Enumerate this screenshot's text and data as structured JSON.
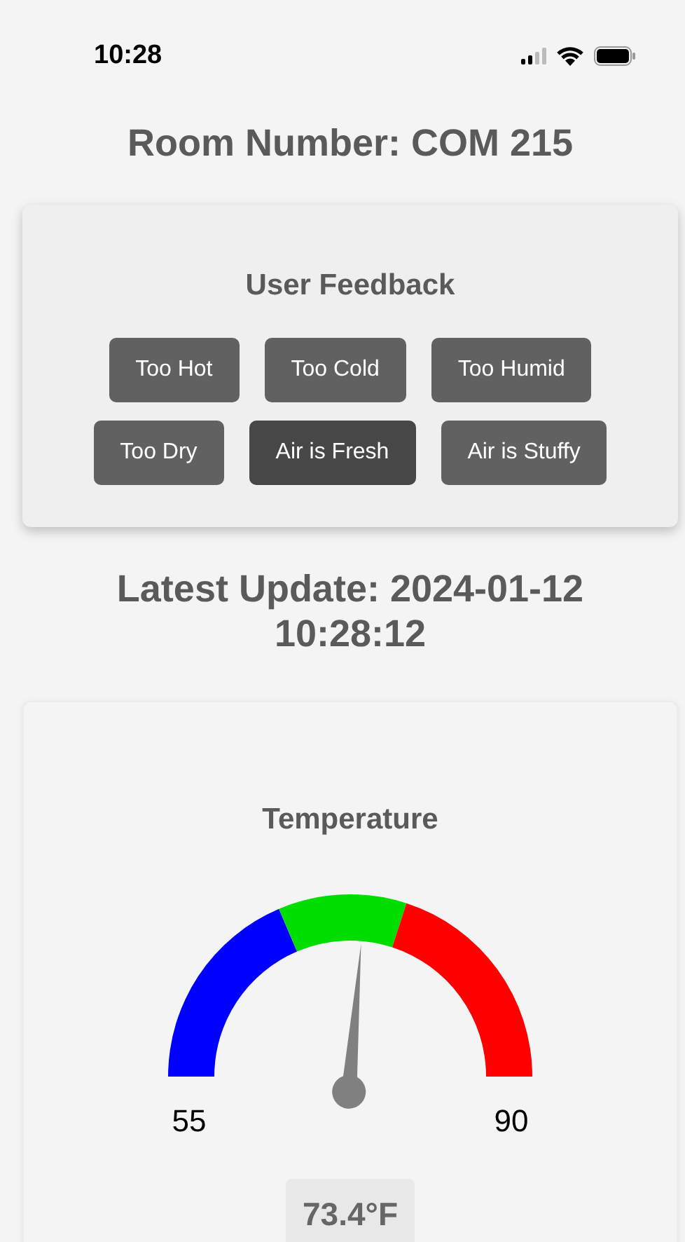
{
  "status_bar": {
    "time": "10:28"
  },
  "room_title": "Room Number: COM 215",
  "feedback": {
    "title": "User Feedback",
    "buttons": [
      {
        "label": "Too Hot",
        "selected": false
      },
      {
        "label": "Too Cold",
        "selected": false
      },
      {
        "label": "Too Humid",
        "selected": false
      },
      {
        "label": "Too Dry",
        "selected": false
      },
      {
        "label": "Air is Fresh",
        "selected": true
      },
      {
        "label": "Air is Stuffy",
        "selected": false
      }
    ]
  },
  "latest_update": "Latest Update: 2024-01-12 10:28:12",
  "temperature": {
    "title": "Temperature",
    "min_label": "55",
    "max_label": "90",
    "zones": [
      {
        "color": "#0000ff"
      },
      {
        "color": "#00dd00"
      },
      {
        "color": "#ff0000"
      }
    ],
    "reading": "73.4°F"
  }
}
